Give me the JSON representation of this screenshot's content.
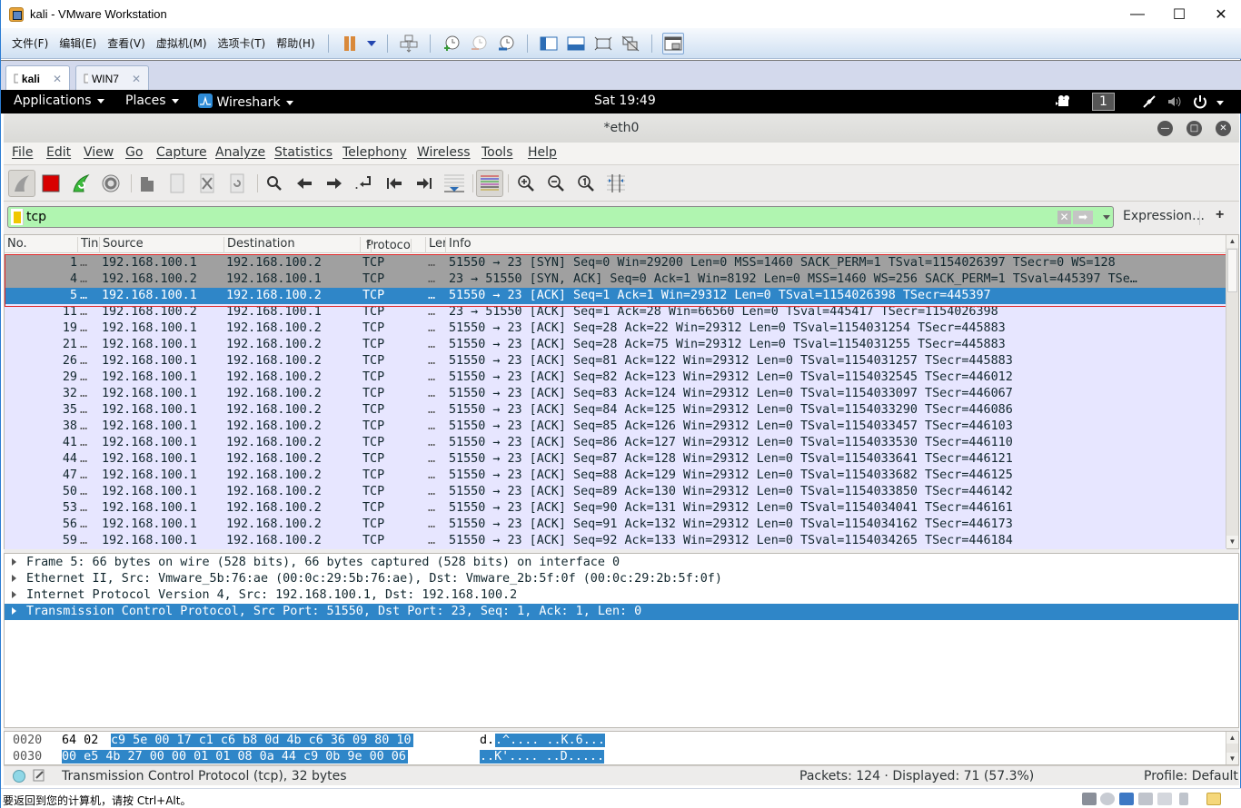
{
  "vmware": {
    "title": "kali - VMware Workstation",
    "window_controls": {
      "minimize": "—",
      "maximize": "☐",
      "close": "✕"
    },
    "menu": [
      "文件(F)",
      "编辑(E)",
      "查看(V)",
      "虚拟机(M)",
      "选项卡(T)",
      "帮助(H)"
    ],
    "toolbar_icons": [
      "pause-icon",
      "dropdown-icon",
      "send-ctrl-alt-del-icon",
      "snapshot-take-icon",
      "snapshot-revert-icon",
      "snapshot-manager-icon",
      "library-view-icon",
      "thumbnail-view-icon",
      "fullscreen-icon",
      "unity-icon",
      "console-view-icon"
    ],
    "tabs": [
      {
        "label": "kali",
        "active": true,
        "close": "✕"
      },
      {
        "label": "WIN7",
        "active": false,
        "close": "✕"
      }
    ],
    "status_message": "要返回到您的计算机，请按 Ctrl+Alt。",
    "device_icons": [
      "hard-disk-icon",
      "cd-dvd-icon",
      "network-icon",
      "printer-icon",
      "sound-icon",
      "usb-icon",
      "message-icon"
    ]
  },
  "kali_bar": {
    "applications": "Applications",
    "places": "Places",
    "wireshark": "Wireshark",
    "clock": "Sat 19:49",
    "workspace": "1"
  },
  "wireshark": {
    "title": "*eth0",
    "menu": [
      "File",
      "Edit",
      "View",
      "Go",
      "Capture",
      "Analyze",
      "Statistics",
      "Telephony",
      "Wireless",
      "Tools",
      "Help"
    ],
    "filter": {
      "value": "tcp",
      "expression_label": "Expression…",
      "add_label": "+"
    },
    "columns": [
      "No.",
      "Time",
      "Source",
      "Destination",
      "Protocol",
      "Length",
      "Info"
    ],
    "column_labels_visible": [
      "No.",
      "Tin",
      "Source",
      "Destination",
      "Protoco",
      "Ler",
      "Info"
    ],
    "packets": [
      {
        "no": "1",
        "time": "…",
        "src": "192.168.100.1",
        "dst": "192.168.100.2",
        "proto": "TCP",
        "len": "…",
        "info": "51550 → 23 [SYN] Seq=0 Win=29200 Len=0 MSS=1460 SACK_PERM=1 TSval=1154026397 TSecr=0 WS=128",
        "style": "gray"
      },
      {
        "no": "4",
        "time": "…",
        "src": "192.168.100.2",
        "dst": "192.168.100.1",
        "proto": "TCP",
        "len": "…",
        "info": "23 → 51550 [SYN, ACK] Seq=0 Ack=1 Win=8192 Len=0 MSS=1460 WS=256 SACK_PERM=1 TSval=445397 TSe…",
        "style": "gray"
      },
      {
        "no": "5",
        "time": "…",
        "src": "192.168.100.1",
        "dst": "192.168.100.2",
        "proto": "TCP",
        "len": "…",
        "info": "51550 → 23 [ACK] Seq=1 Ack=1 Win=29312 Len=0 TSval=1154026398 TSecr=445397",
        "style": "sel"
      },
      {
        "no": "11",
        "time": "…",
        "src": "192.168.100.2",
        "dst": "192.168.100.1",
        "proto": "TCP",
        "len": "…",
        "info": "23 → 51550 [ACK] Seq=1 Ack=28 Win=66560 Len=0 TSval=445417 TSecr=1154026398",
        "style": "normal"
      },
      {
        "no": "19",
        "time": "…",
        "src": "192.168.100.1",
        "dst": "192.168.100.2",
        "proto": "TCP",
        "len": "…",
        "info": "51550 → 23 [ACK] Seq=28 Ack=22 Win=29312 Len=0 TSval=1154031254 TSecr=445883",
        "style": "normal"
      },
      {
        "no": "21",
        "time": "…",
        "src": "192.168.100.1",
        "dst": "192.168.100.2",
        "proto": "TCP",
        "len": "…",
        "info": "51550 → 23 [ACK] Seq=28 Ack=75 Win=29312 Len=0 TSval=1154031255 TSecr=445883",
        "style": "normal"
      },
      {
        "no": "26",
        "time": "…",
        "src": "192.168.100.1",
        "dst": "192.168.100.2",
        "proto": "TCP",
        "len": "…",
        "info": "51550 → 23 [ACK] Seq=81 Ack=122 Win=29312 Len=0 TSval=1154031257 TSecr=445883",
        "style": "normal"
      },
      {
        "no": "29",
        "time": "…",
        "src": "192.168.100.1",
        "dst": "192.168.100.2",
        "proto": "TCP",
        "len": "…",
        "info": "51550 → 23 [ACK] Seq=82 Ack=123 Win=29312 Len=0 TSval=1154032545 TSecr=446012",
        "style": "normal"
      },
      {
        "no": "32",
        "time": "…",
        "src": "192.168.100.1",
        "dst": "192.168.100.2",
        "proto": "TCP",
        "len": "…",
        "info": "51550 → 23 [ACK] Seq=83 Ack=124 Win=29312 Len=0 TSval=1154033097 TSecr=446067",
        "style": "normal"
      },
      {
        "no": "35",
        "time": "…",
        "src": "192.168.100.1",
        "dst": "192.168.100.2",
        "proto": "TCP",
        "len": "…",
        "info": "51550 → 23 [ACK] Seq=84 Ack=125 Win=29312 Len=0 TSval=1154033290 TSecr=446086",
        "style": "normal"
      },
      {
        "no": "38",
        "time": "…",
        "src": "192.168.100.1",
        "dst": "192.168.100.2",
        "proto": "TCP",
        "len": "…",
        "info": "51550 → 23 [ACK] Seq=85 Ack=126 Win=29312 Len=0 TSval=1154033457 TSecr=446103",
        "style": "normal"
      },
      {
        "no": "41",
        "time": "…",
        "src": "192.168.100.1",
        "dst": "192.168.100.2",
        "proto": "TCP",
        "len": "…",
        "info": "51550 → 23 [ACK] Seq=86 Ack=127 Win=29312 Len=0 TSval=1154033530 TSecr=446110",
        "style": "normal"
      },
      {
        "no": "44",
        "time": "…",
        "src": "192.168.100.1",
        "dst": "192.168.100.2",
        "proto": "TCP",
        "len": "…",
        "info": "51550 → 23 [ACK] Seq=87 Ack=128 Win=29312 Len=0 TSval=1154033641 TSecr=446121",
        "style": "normal"
      },
      {
        "no": "47",
        "time": "…",
        "src": "192.168.100.1",
        "dst": "192.168.100.2",
        "proto": "TCP",
        "len": "…",
        "info": "51550 → 23 [ACK] Seq=88 Ack=129 Win=29312 Len=0 TSval=1154033682 TSecr=446125",
        "style": "normal"
      },
      {
        "no": "50",
        "time": "…",
        "src": "192.168.100.1",
        "dst": "192.168.100.2",
        "proto": "TCP",
        "len": "…",
        "info": "51550 → 23 [ACK] Seq=89 Ack=130 Win=29312 Len=0 TSval=1154033850 TSecr=446142",
        "style": "normal"
      },
      {
        "no": "53",
        "time": "…",
        "src": "192.168.100.1",
        "dst": "192.168.100.2",
        "proto": "TCP",
        "len": "…",
        "info": "51550 → 23 [ACK] Seq=90 Ack=131 Win=29312 Len=0 TSval=1154034041 TSecr=446161",
        "style": "normal"
      },
      {
        "no": "56",
        "time": "…",
        "src": "192.168.100.1",
        "dst": "192.168.100.2",
        "proto": "TCP",
        "len": "…",
        "info": "51550 → 23 [ACK] Seq=91 Ack=132 Win=29312 Len=0 TSval=1154034162 TSecr=446173",
        "style": "normal"
      },
      {
        "no": "59",
        "time": "…",
        "src": "192.168.100.1",
        "dst": "192.168.100.2",
        "proto": "TCP",
        "len": "…",
        "info": "51550 → 23 [ACK] Seq=92 Ack=133 Win=29312 Len=0 TSval=1154034265 TSecr=446184",
        "style": "normal"
      }
    ],
    "details": [
      {
        "text": "Frame 5: 66 bytes on wire (528 bits), 66 bytes captured (528 bits) on interface 0",
        "selected": false
      },
      {
        "text": "Ethernet II, Src: Vmware_5b:76:ae (00:0c:29:5b:76:ae), Dst: Vmware_2b:5f:0f (00:0c:29:2b:5f:0f)",
        "selected": false
      },
      {
        "text": "Internet Protocol Version 4, Src: 192.168.100.1, Dst: 192.168.100.2",
        "selected": false
      },
      {
        "text": "Transmission Control Protocol, Src Port: 51550, Dst Port: 23, Seq: 1, Ack: 1, Len: 0",
        "selected": true
      }
    ],
    "bytes": [
      {
        "offset": "0020",
        "hex_plain": "64 02 ",
        "hex_hl": "c9 5e 00 17 c1 c6  b8 0d 4b c6 36 09 80 10",
        "ascii_plain": "d.",
        "ascii_hl": ".^.... ..K.6..."
      },
      {
        "offset": "0030",
        "hex_plain": "",
        "hex_hl": "00 e5 4b 27 00 00 01 01  08 0a 44 c9 0b 9e 00 06",
        "ascii_plain": "",
        "ascii_hl": "..K'.... ..D....."
      }
    ],
    "status": {
      "field": "Transmission Control Protocol (tcp), 32 bytes",
      "packets": "Packets: 124 · Displayed: 71 (57.3%)",
      "profile": "Profile: Default"
    }
  },
  "colors": {
    "selected": "#2f86c8",
    "row_default": "#e7e6ff",
    "row_syn": "#a0a0a0",
    "filter_ok": "#b0f5b0",
    "highlight_box": "#e02828"
  }
}
